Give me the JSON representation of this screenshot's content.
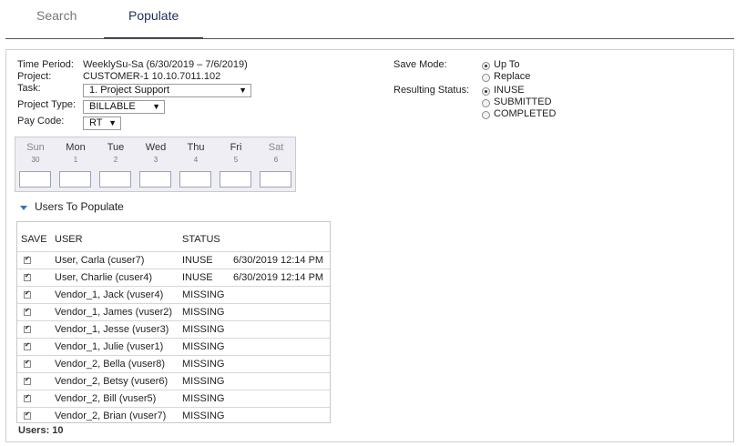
{
  "tabs": [
    {
      "label": "Search"
    },
    {
      "label": "Populate"
    }
  ],
  "form": {
    "time_period_label": "Time Period:",
    "time_period_value": "WeeklySu-Sa (6/30/2019 – 7/6/2019)",
    "project_label": "Project:",
    "project_value": "CUSTOMER-1 10.10.7011.102",
    "task_label": "Task:",
    "task_value": "1. Project Support",
    "project_type_label": "Project Type:",
    "project_type_value": "BILLABLE",
    "pay_code_label": "Pay Code:",
    "pay_code_value": "RT"
  },
  "save_mode": {
    "label": "Save Mode:",
    "options": [
      {
        "label": "Up To",
        "selected": true
      },
      {
        "label": "Replace",
        "selected": false
      }
    ]
  },
  "resulting_status": {
    "label": "Resulting Status:",
    "options": [
      {
        "label": "INUSE",
        "selected": true
      },
      {
        "label": "SUBMITTED",
        "selected": false
      },
      {
        "label": "COMPLETED",
        "selected": false
      }
    ]
  },
  "days": [
    {
      "name": "Sun",
      "num": "30"
    },
    {
      "name": "Mon",
      "num": "1"
    },
    {
      "name": "Tue",
      "num": "2"
    },
    {
      "name": "Wed",
      "num": "3"
    },
    {
      "name": "Thu",
      "num": "4"
    },
    {
      "name": "Fri",
      "num": "5"
    },
    {
      "name": "Sat",
      "num": "6"
    }
  ],
  "users_section": {
    "title": "Users To Populate",
    "columns": {
      "save": "SAVE",
      "user": "USER",
      "status": "STATUS"
    },
    "rows": [
      {
        "user": "User, Carla (cuser7)",
        "status": "INUSE",
        "timestamp": "6/30/2019 12:14 PM"
      },
      {
        "user": "User, Charlie (cuser4)",
        "status": "INUSE",
        "timestamp": "6/30/2019 12:14 PM"
      },
      {
        "user": "Vendor_1, Jack (vuser4)",
        "status": "MISSING",
        "timestamp": ""
      },
      {
        "user": "Vendor_1, James (vuser2)",
        "status": "MISSING",
        "timestamp": ""
      },
      {
        "user": "Vendor_1, Jesse (vuser3)",
        "status": "MISSING",
        "timestamp": ""
      },
      {
        "user": "Vendor_1, Julie (vuser1)",
        "status": "MISSING",
        "timestamp": ""
      },
      {
        "user": "Vendor_2, Bella (vuser8)",
        "status": "MISSING",
        "timestamp": ""
      },
      {
        "user": "Vendor_2, Betsy (vuser6)",
        "status": "MISSING",
        "timestamp": ""
      },
      {
        "user": "Vendor_2, Bill (vuser5)",
        "status": "MISSING",
        "timestamp": ""
      },
      {
        "user": "Vendor_2, Brian (vuser7)",
        "status": "MISSING",
        "timestamp": ""
      }
    ],
    "count_label": "Users: 10"
  }
}
